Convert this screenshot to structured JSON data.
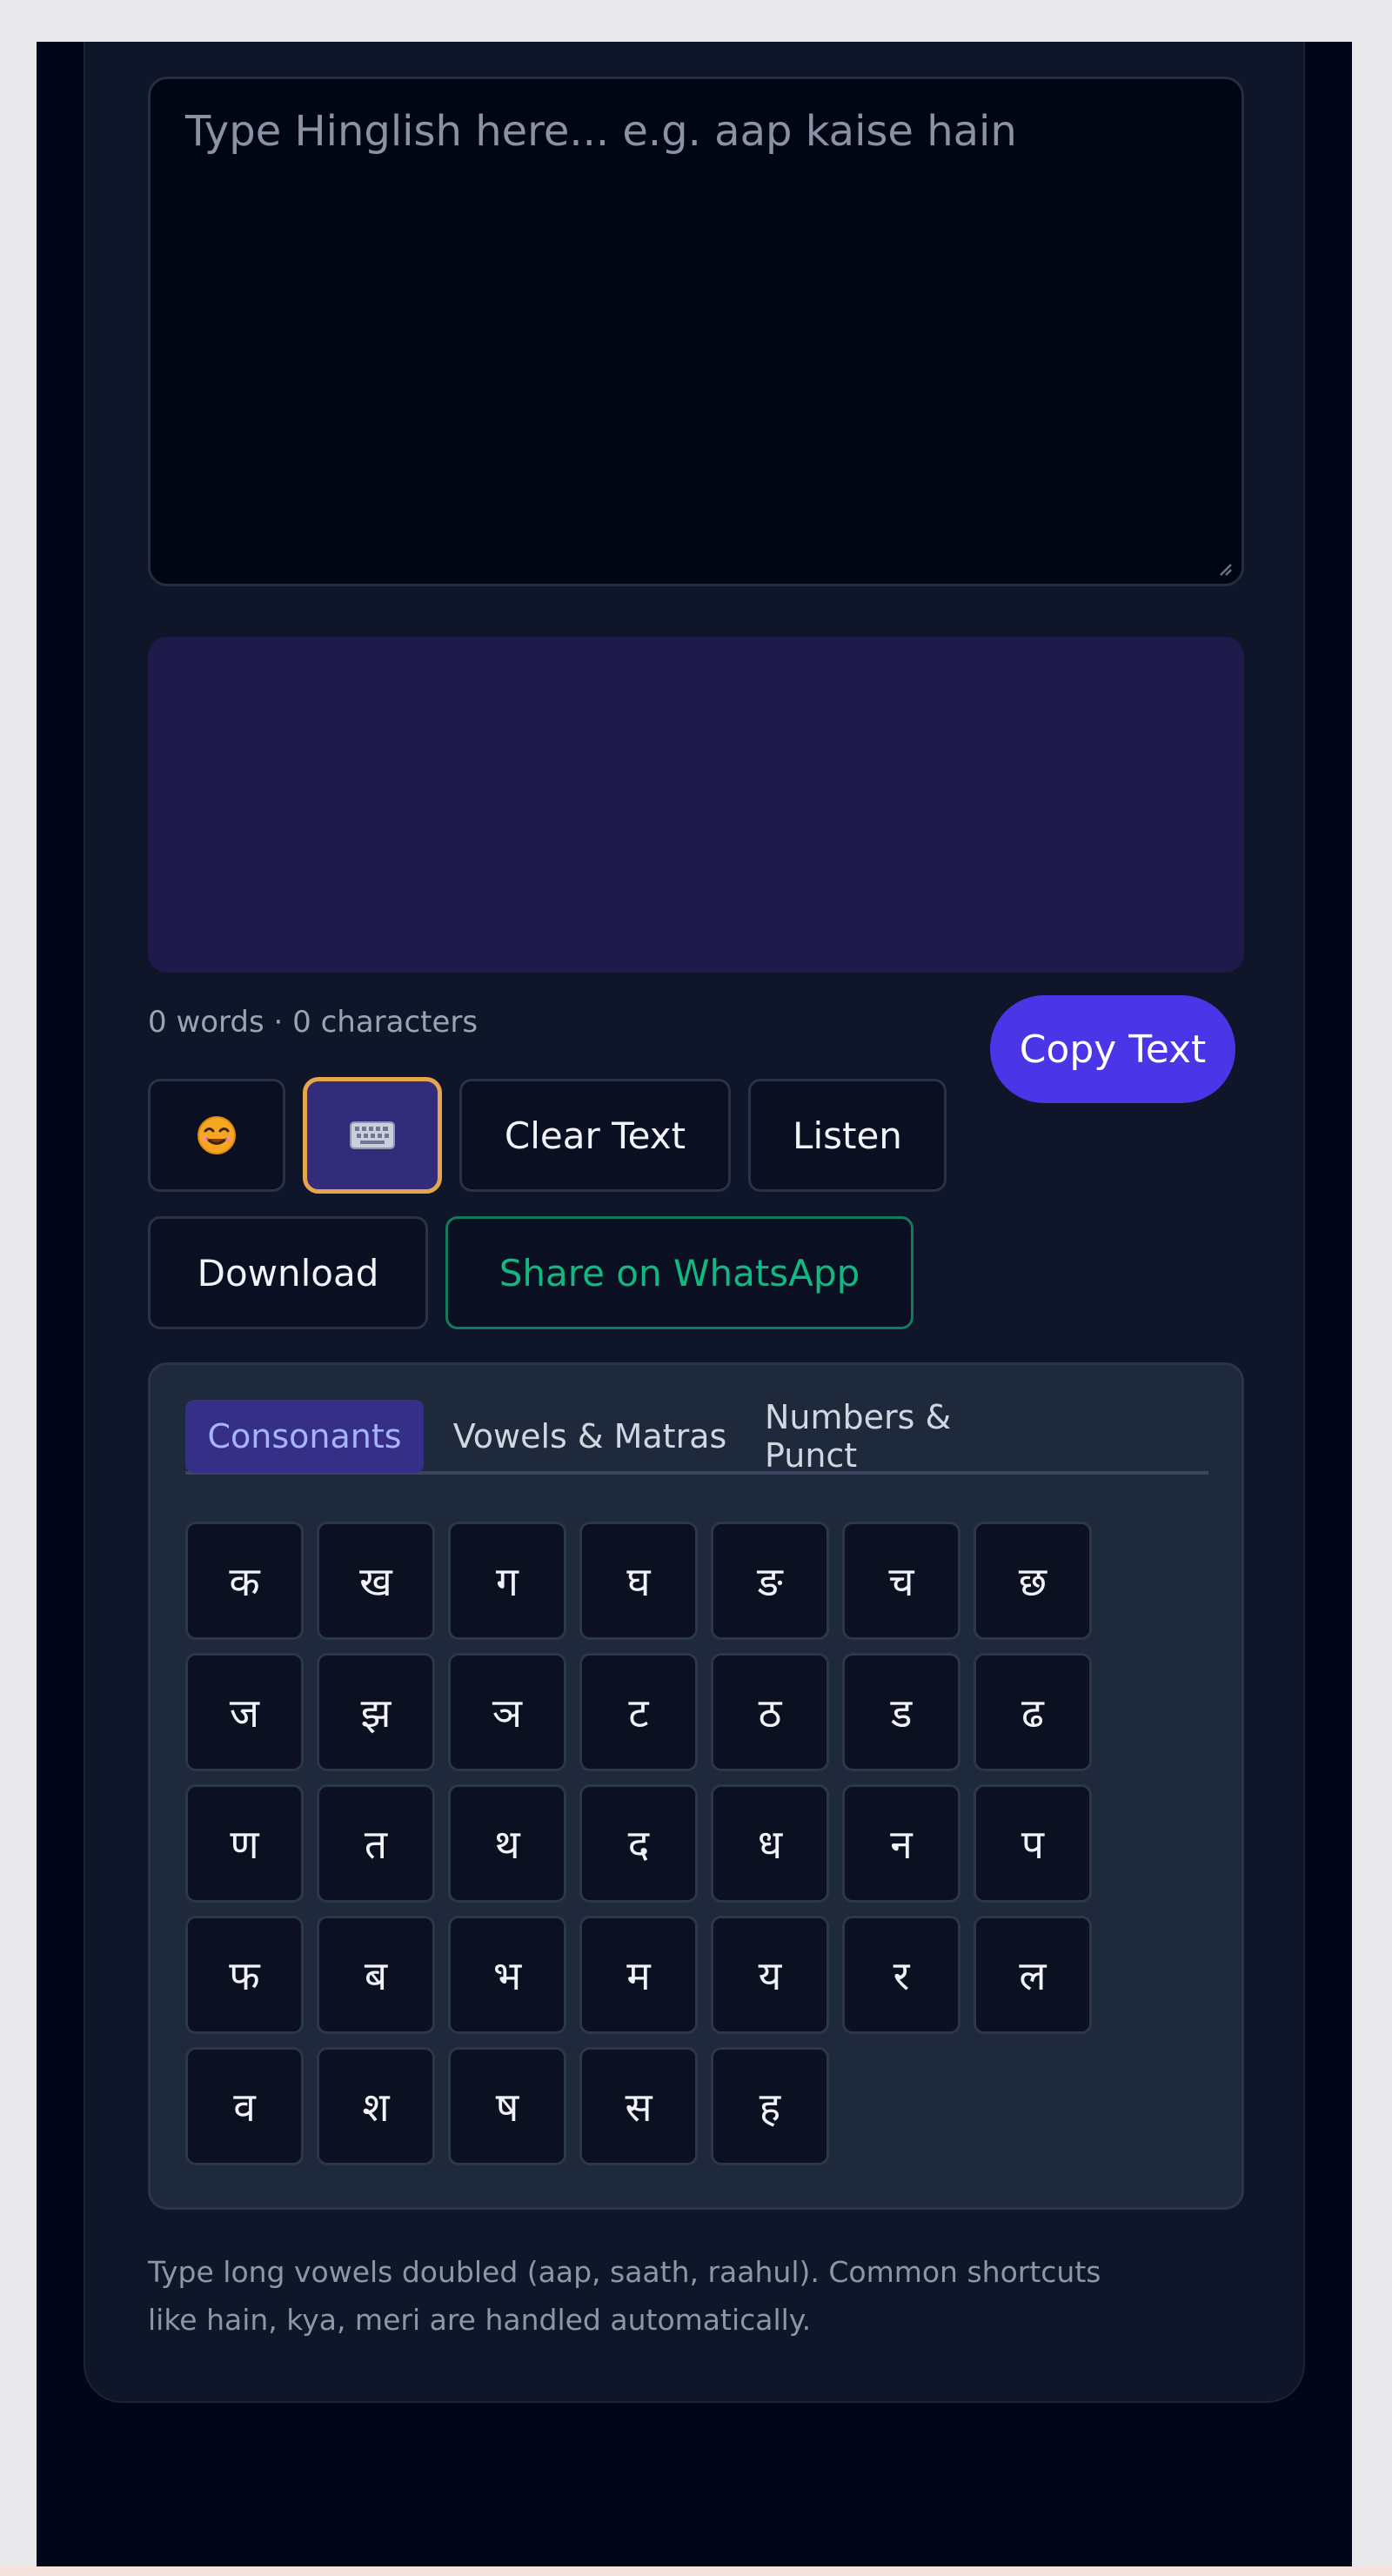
{
  "input": {
    "placeholder": "Type Hinglish here... e.g. aap kaise hain",
    "value": ""
  },
  "output": {
    "value": ""
  },
  "counter": "0 words · 0 characters",
  "buttons": {
    "copy": "Copy Text",
    "emoji_icon": "smiley-face-icon",
    "keyboard_icon": "keyboard-icon",
    "clear": "Clear Text",
    "listen": "Listen",
    "download": "Download",
    "share": "Share on WhatsApp"
  },
  "keyboard": {
    "tabs": [
      {
        "label": "Consonants",
        "active": true
      },
      {
        "label": "Vowels & Matras",
        "active": false
      },
      {
        "label": "Numbers & Punct",
        "active": false
      }
    ],
    "keys": [
      "क",
      "ख",
      "ग",
      "घ",
      "ङ",
      "च",
      "छ",
      "ज",
      "झ",
      "ञ",
      "ट",
      "ठ",
      "ड",
      "ढ",
      "ण",
      "त",
      "थ",
      "द",
      "ध",
      "न",
      "प",
      "फ",
      "ब",
      "भ",
      "म",
      "य",
      "र",
      "ल",
      "व",
      "श",
      "ष",
      "स",
      "ह"
    ]
  },
  "hint": [
    "Type long vowels doubled (aap, saath, raahul). Common shortcuts",
    "like hain, kya, meri are handled automatically."
  ],
  "colors": {
    "accent": "#4a36e6",
    "whatsapp": "#10b981",
    "keyboard_active_border": "#e8a64c",
    "background": "#010619",
    "card": "#0f1629"
  }
}
